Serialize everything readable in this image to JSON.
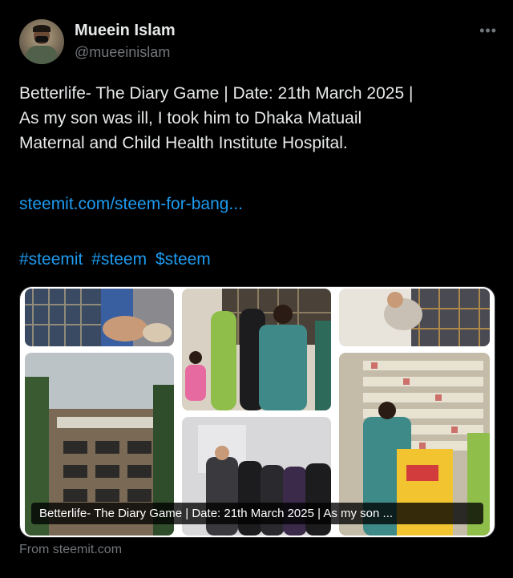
{
  "author": {
    "name": "Mueein Islam",
    "handle": "@mueeinislam"
  },
  "more_icon": "more-horizontal-icon",
  "tweet": {
    "lines": [
      "Betterlife- The Diary Game | Date: 21th March 2025 |",
      "As my son was ill, I took him to Dhaka Matuail",
      "Maternal and Child Health Institute Hospital."
    ],
    "link": "steemit.com/steem-for-bang...",
    "hashtags": [
      "#steemit",
      "#steem",
      "$steem"
    ]
  },
  "card": {
    "caption": "Betterlife- The Diary Game | Date: 21th March 2025 | As my son ..."
  },
  "source": "From steemit.com",
  "colors": {
    "background": "#000000",
    "text": "#e7e9ea",
    "muted": "#71767b",
    "link": "#1d9bf0"
  }
}
